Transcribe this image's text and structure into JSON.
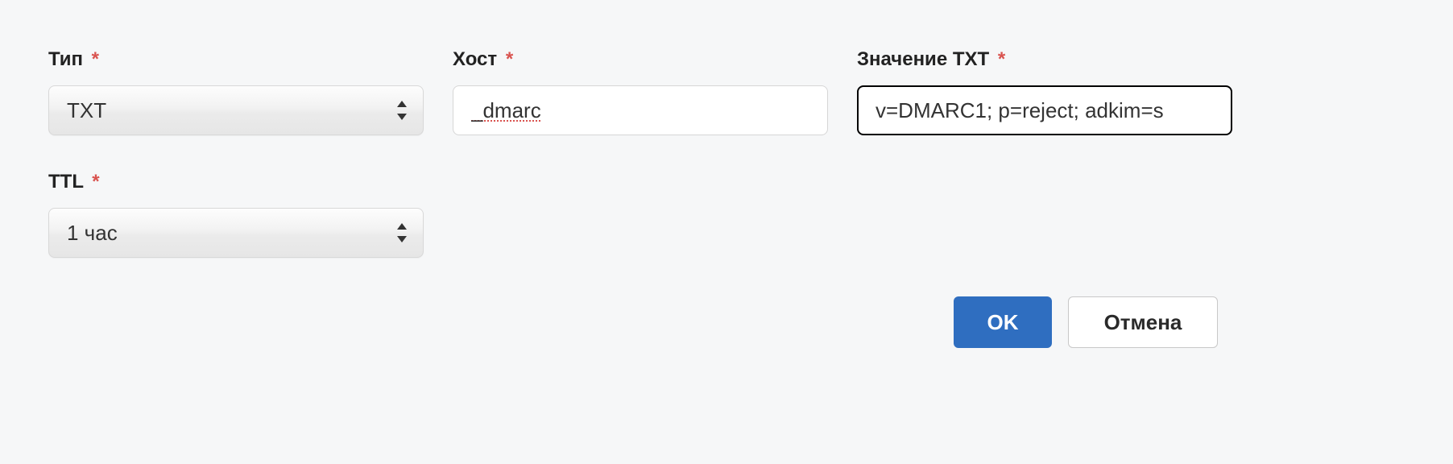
{
  "labels": {
    "type": "Тип",
    "host": "Хост",
    "txt_value": "Значение TXT",
    "ttl": "TTL"
  },
  "required_marker": "*",
  "select": {
    "type_value": "TXT",
    "ttl_value": "1 час"
  },
  "inputs": {
    "host_value": "_dmarc",
    "txt_value_value": "v=DMARC1; p=reject; adkim=s"
  },
  "buttons": {
    "ok": "OK",
    "cancel": "Отмена"
  }
}
